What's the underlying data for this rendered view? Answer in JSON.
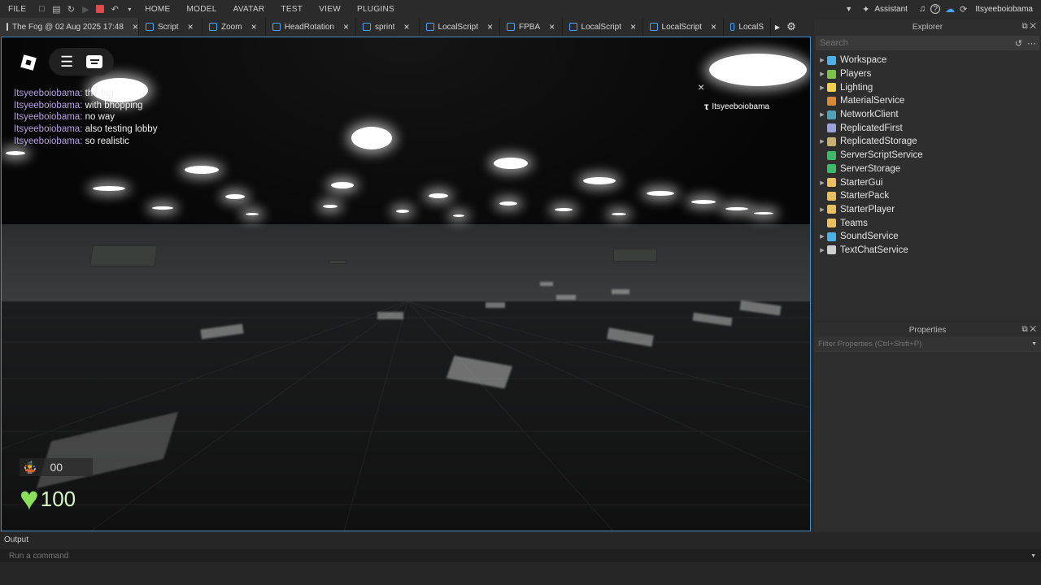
{
  "menu": {
    "items": [
      "FILE",
      "HOME",
      "MODEL",
      "AVATAR",
      "TEST",
      "VIEW",
      "PLUGINS"
    ],
    "assistant": "Assistant",
    "username": "Itsyeeboiobama"
  },
  "tabs": [
    {
      "label": "The Fog @ 02 Aug 2025 17:48",
      "active": true
    },
    {
      "label": "Script"
    },
    {
      "label": "Zoom"
    },
    {
      "label": "HeadRotation"
    },
    {
      "label": "sprint"
    },
    {
      "label": "LocalScript"
    },
    {
      "label": "FPBA"
    },
    {
      "label": "LocalScript"
    },
    {
      "label": "LocalScript"
    },
    {
      "label": "LocalS"
    }
  ],
  "game": {
    "player_tag": "Itsyeeboiobama",
    "stamina": "00",
    "health": "100",
    "chat": [
      {
        "user": "Itsyeeboiobama:",
        "msg": "the fog"
      },
      {
        "user": "Itsyeeboiobama:",
        "msg": "with bhopping"
      },
      {
        "user": "Itsyeeboiobama:",
        "msg": "no way"
      },
      {
        "user": "Itsyeeboiobama:",
        "msg": "also testing lobby"
      },
      {
        "user": "Itsyeeboiobama:",
        "msg": "so realistic"
      }
    ]
  },
  "explorer": {
    "title": "Explorer",
    "search_placeholder": "Search",
    "items": [
      {
        "label": "Workspace",
        "color": "#4fb0e8",
        "expandable": true
      },
      {
        "label": "Players",
        "color": "#7cc24a",
        "expandable": true
      },
      {
        "label": "Lighting",
        "color": "#f2d14a",
        "expandable": true
      },
      {
        "label": "MaterialService",
        "color": "#d88a3a",
        "expandable": false
      },
      {
        "label": "NetworkClient",
        "color": "#4fa0b8",
        "expandable": true
      },
      {
        "label": "ReplicatedFirst",
        "color": "#9aa0d8",
        "expandable": false
      },
      {
        "label": "ReplicatedStorage",
        "color": "#c8b070",
        "expandable": true
      },
      {
        "label": "ServerScriptService",
        "color": "#3cba6a",
        "expandable": false
      },
      {
        "label": "ServerStorage",
        "color": "#3cba6a",
        "expandable": false
      },
      {
        "label": "StarterGui",
        "color": "#e8c060",
        "expandable": true
      },
      {
        "label": "StarterPack",
        "color": "#e8c060",
        "expandable": false
      },
      {
        "label": "StarterPlayer",
        "color": "#e8c060",
        "expandable": true
      },
      {
        "label": "Teams",
        "color": "#e8c060",
        "expandable": false
      },
      {
        "label": "SoundService",
        "color": "#4fb0e8",
        "expandable": true
      },
      {
        "label": "TextChatService",
        "color": "#cfcfcf",
        "expandable": true
      }
    ]
  },
  "properties": {
    "title": "Properties",
    "filter_placeholder": "Filter Properties (Ctrl+Shift+P)"
  },
  "output": {
    "title": "Output",
    "command_placeholder": "Run a command"
  }
}
